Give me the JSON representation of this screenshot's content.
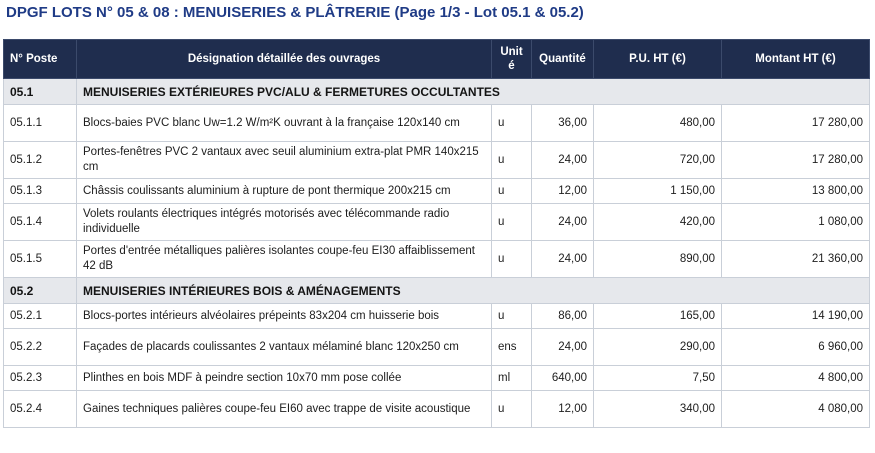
{
  "title": "DPGF LOTS N° 05 & 08 : MENUISERIES & PLÂTRERIE (Page 1/3 - Lot 05.1 & 05.2)",
  "columns": {
    "poste": "N° Poste",
    "designation": "Désignation détaillée des ouvrages",
    "unit_line1": "Unit",
    "unit_line2": "é",
    "quantite": "Quantité",
    "pu": "P.U. HT (€)",
    "montant": "Montant HT (€)"
  },
  "sections": [
    {
      "code": "05.1",
      "title": "MENUISERIES EXTÉRIEURES PVC/ALU & FERMETURES OCCULTANTES",
      "items": [
        {
          "poste": "05.1.1",
          "designation": "Blocs-baies PVC blanc Uw=1.2 W/m²K ouvrant à la française 120x140 cm",
          "unit": "u",
          "quantite": "36,00",
          "pu": "480,00",
          "montant": "17 280,00"
        },
        {
          "poste": "05.1.2",
          "designation": "Portes-fenêtres PVC 2 vantaux avec seuil aluminium extra-plat PMR 140x215 cm",
          "unit": "u",
          "quantite": "24,00",
          "pu": "720,00",
          "montant": "17 280,00"
        },
        {
          "poste": "05.1.3",
          "designation": "Châssis coulissants aluminium à rupture de pont thermique 200x215 cm",
          "unit": "u",
          "quantite": "12,00",
          "pu": "1 150,00",
          "montant": "13 800,00"
        },
        {
          "poste": "05.1.4",
          "designation": "Volets roulants électriques intégrés motorisés avec télécommande radio individuelle",
          "unit": "u",
          "quantite": "24,00",
          "pu": "420,00",
          "montant": "1 080,00"
        },
        {
          "poste": "05.1.5",
          "designation": "Portes d'entrée métalliques palières isolantes coupe-feu EI30 affaiblissement 42 dB",
          "unit": "u",
          "quantite": "24,00",
          "pu": "890,00",
          "montant": "21 360,00"
        }
      ]
    },
    {
      "code": "05.2",
      "title": "MENUISERIES INTÉRIEURES BOIS & AMÉNAGEMENTS",
      "items": [
        {
          "poste": "05.2.1",
          "designation": "Blocs-portes intérieurs alvéolaires prépeints 83x204 cm huisserie bois",
          "unit": "u",
          "quantite": "86,00",
          "pu": "165,00",
          "montant": "14 190,00"
        },
        {
          "poste": "05.2.2",
          "designation": "Façades de placards coulissantes 2 vantaux mélaminé blanc 120x250 cm",
          "unit": "ens",
          "quantite": "24,00",
          "pu": "290,00",
          "montant": "6 960,00"
        },
        {
          "poste": "05.2.3",
          "designation": "Plinthes en bois MDF à peindre section 10x70 mm pose collée",
          "unit": "ml",
          "quantite": "640,00",
          "pu": "7,50",
          "montant": "4 800,00"
        },
        {
          "poste": "05.2.4",
          "designation": "Gaines techniques palières coupe-feu EI60 avec trappe de visite acoustique",
          "unit": "u",
          "quantite": "12,00",
          "pu": "340,00",
          "montant": "4 080,00"
        }
      ]
    }
  ],
  "colors": {
    "title": "#1f3b86",
    "header_bg": "#1f2d4e",
    "section_bg": "#e6e8ec",
    "border": "#c9cfd8"
  }
}
